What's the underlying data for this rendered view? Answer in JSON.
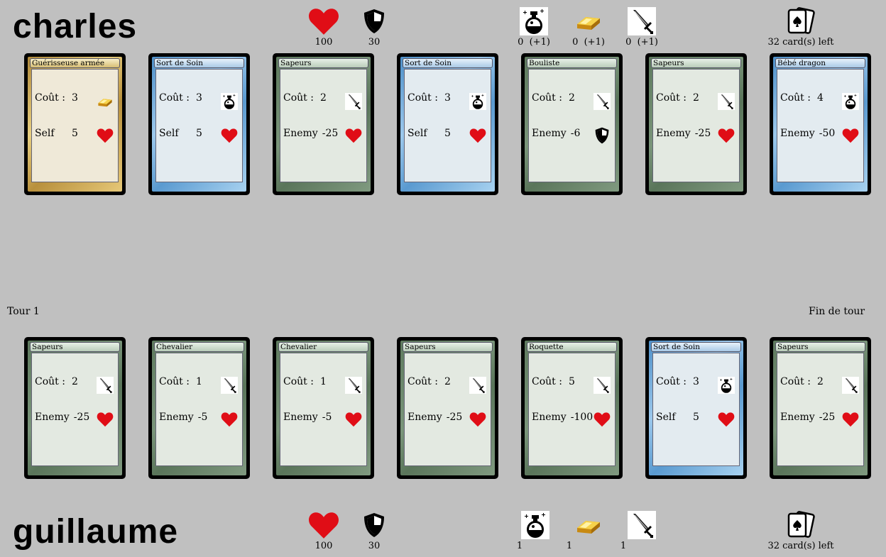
{
  "top_player": {
    "name": "charles",
    "health": "100",
    "shield": "30",
    "potion": "0  (+1)",
    "gold": "0  (+1)",
    "sword": "0  (+1)",
    "deck": "32 card(s) left",
    "cards": [
      {
        "title": "Guérisseuse armée",
        "color": "gold",
        "cost_label": "Coût :",
        "cost": "3",
        "cost_icon": "gold",
        "effect_label": "Self",
        "effect": "5",
        "effect_icon": "heart"
      },
      {
        "title": "Sort de Soin",
        "color": "blue",
        "cost_label": "Coût :",
        "cost": "3",
        "cost_icon": "potion",
        "effect_label": "Self",
        "effect": "5",
        "effect_icon": "heart"
      },
      {
        "title": "Sapeurs",
        "color": "green",
        "cost_label": "Coût :",
        "cost": "2",
        "cost_icon": "sword",
        "effect_label": "Enemy",
        "effect": "-25",
        "effect_icon": "heart"
      },
      {
        "title": "Sort de Soin",
        "color": "blue",
        "cost_label": "Coût :",
        "cost": "3",
        "cost_icon": "potion",
        "effect_label": "Self",
        "effect": "5",
        "effect_icon": "heart"
      },
      {
        "title": "Bouliste",
        "color": "green",
        "cost_label": "Coût :",
        "cost": "2",
        "cost_icon": "sword",
        "effect_label": "Enemy",
        "effect": "-6",
        "effect_icon": "shield"
      },
      {
        "title": "Sapeurs",
        "color": "green",
        "cost_label": "Coût :",
        "cost": "2",
        "cost_icon": "sword",
        "effect_label": "Enemy",
        "effect": "-25",
        "effect_icon": "heart"
      },
      {
        "title": "Bébé dragon",
        "color": "blue",
        "cost_label": "Coût :",
        "cost": "4",
        "cost_icon": "potion",
        "effect_label": "Enemy",
        "effect": "-50",
        "effect_icon": "heart"
      }
    ]
  },
  "bottom_player": {
    "name": "guillaume",
    "health": "100",
    "shield": "30",
    "potion": "1",
    "gold": "1",
    "sword": "1",
    "deck": "32 card(s) left",
    "cards": [
      {
        "title": "Sapeurs",
        "color": "green",
        "cost_label": "Coût :",
        "cost": "2",
        "cost_icon": "sword",
        "effect_label": "Enemy",
        "effect": "-25",
        "effect_icon": "heart"
      },
      {
        "title": "Chevalier",
        "color": "green",
        "cost_label": "Coût :",
        "cost": "1",
        "cost_icon": "sword",
        "effect_label": "Enemy",
        "effect": "-5",
        "effect_icon": "heart"
      },
      {
        "title": "Chevalier",
        "color": "green",
        "cost_label": "Coût :",
        "cost": "1",
        "cost_icon": "sword",
        "effect_label": "Enemy",
        "effect": "-5",
        "effect_icon": "heart"
      },
      {
        "title": "Sapeurs",
        "color": "green",
        "cost_label": "Coût :",
        "cost": "2",
        "cost_icon": "sword",
        "effect_label": "Enemy",
        "effect": "-25",
        "effect_icon": "heart"
      },
      {
        "title": "Roquette",
        "color": "green",
        "cost_label": "Coût :",
        "cost": "5",
        "cost_icon": "sword",
        "effect_label": "Enemy",
        "effect": "-100",
        "effect_icon": "heart"
      },
      {
        "title": "Sort de Soin",
        "color": "blue",
        "cost_label": "Coût :",
        "cost": "3",
        "cost_icon": "potion",
        "effect_label": "Self",
        "effect": "5",
        "effect_icon": "heart"
      },
      {
        "title": "Sapeurs",
        "color": "green",
        "cost_label": "Coût :",
        "cost": "2",
        "cost_icon": "sword",
        "effect_label": "Enemy",
        "effect": "-25",
        "effect_icon": "heart"
      }
    ]
  },
  "turn_label": "Tour 1",
  "end_turn_label": "Fin de tour",
  "colors": {
    "heart": "#e00d16",
    "background": "#c0c0c0"
  }
}
